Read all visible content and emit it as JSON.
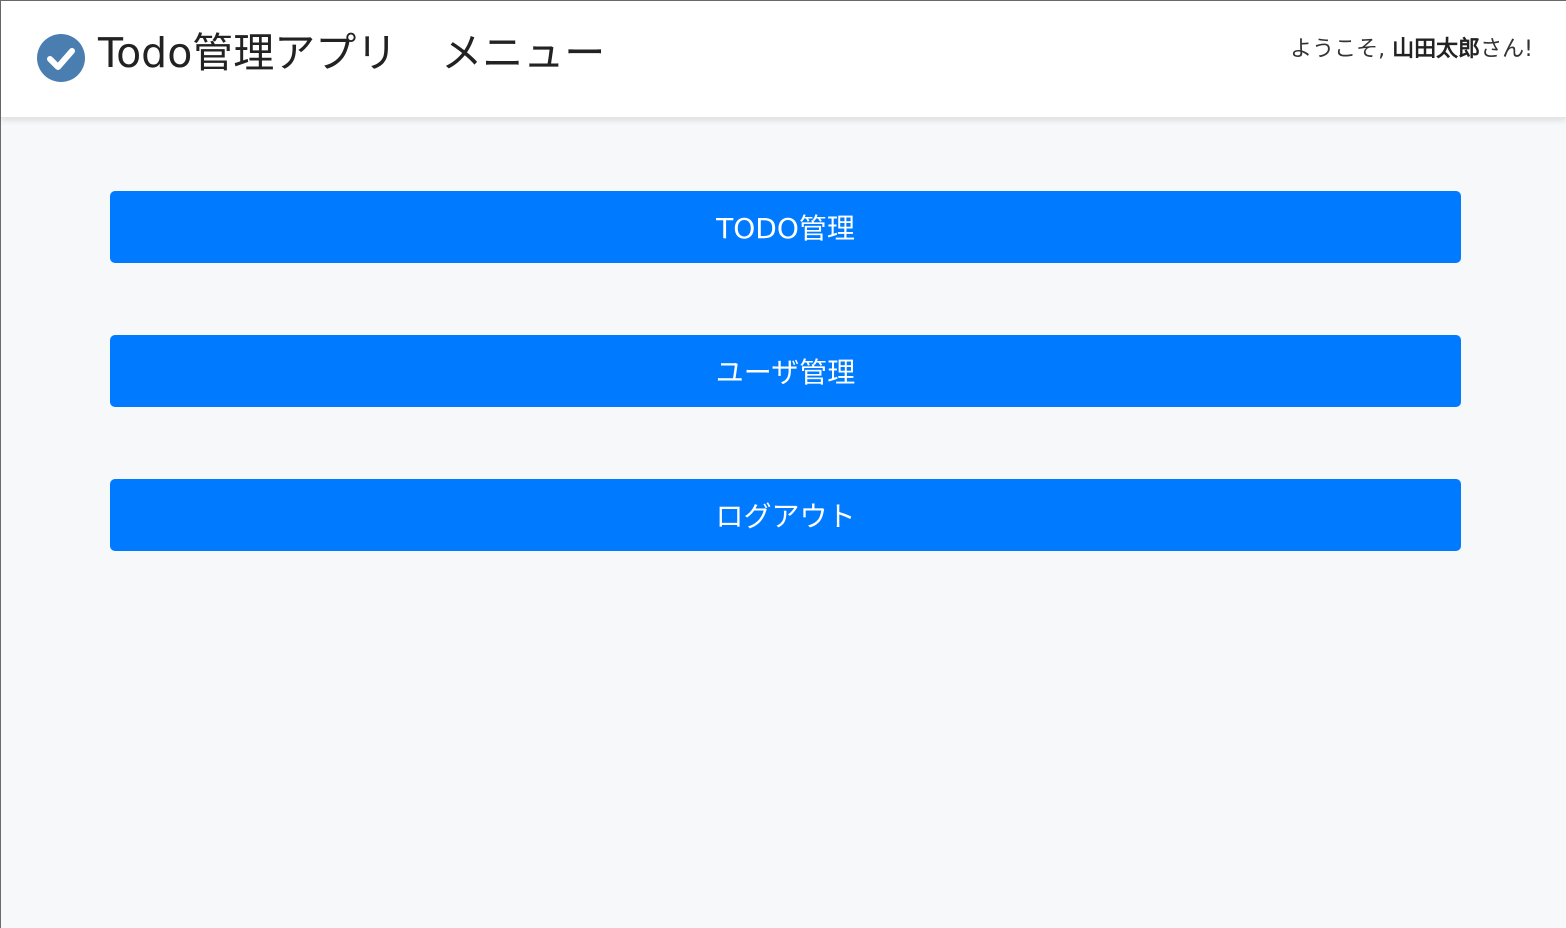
{
  "header": {
    "logo_icon": "check-circle-icon",
    "logo_color": "#4a7eb1",
    "app_title": "Todo管理アプリ",
    "page_name": "メニュー",
    "welcome_prefix": "ようこそ, ",
    "user_name": "山田太郎",
    "welcome_suffix": "さん!"
  },
  "menu": {
    "items": [
      {
        "label": "TODO管理"
      },
      {
        "label": "ユーザ管理"
      },
      {
        "label": "ログアウト"
      }
    ],
    "button_color": "#007bff"
  }
}
